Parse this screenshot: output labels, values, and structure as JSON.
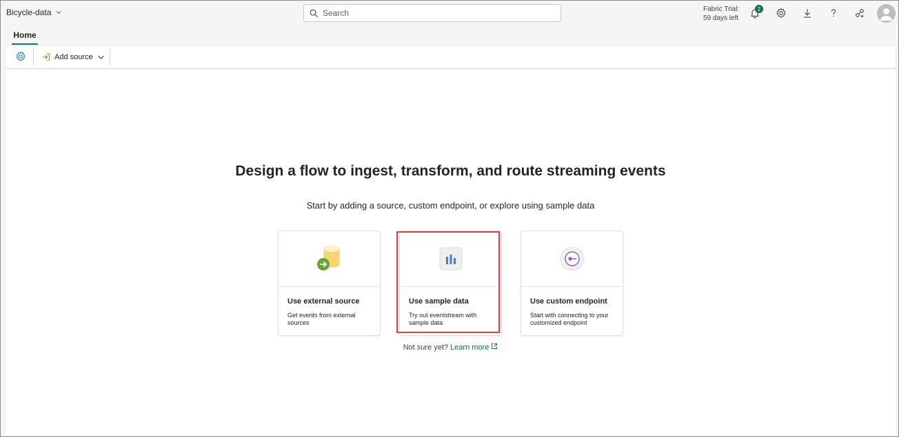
{
  "header": {
    "workspace_name": "Bicycle-data",
    "search_placeholder": "Search",
    "trial_line1": "Fabric Trial:",
    "trial_line2": "59 days left",
    "notification_count": "2"
  },
  "tabs": [
    {
      "label": "Home"
    }
  ],
  "toolbar": {
    "add_source_label": "Add source"
  },
  "main": {
    "headline": "Design a flow to ingest, transform, and route streaming events",
    "subline": "Start by adding a source, custom endpoint, or explore using sample data",
    "cards": [
      {
        "title": "Use external source",
        "description": "Get events from external sources"
      },
      {
        "title": "Use sample data",
        "description": "Try out eventstream with sample data"
      },
      {
        "title": "Use custom endpoint",
        "description": "Start with connecting to your customized endpoint"
      }
    ],
    "footer_text": "Not sure yet?",
    "learn_more": "Learn more"
  },
  "colors": {
    "accent": "#117865",
    "highlight": "#e43b44",
    "link": "#0f6e4f"
  }
}
